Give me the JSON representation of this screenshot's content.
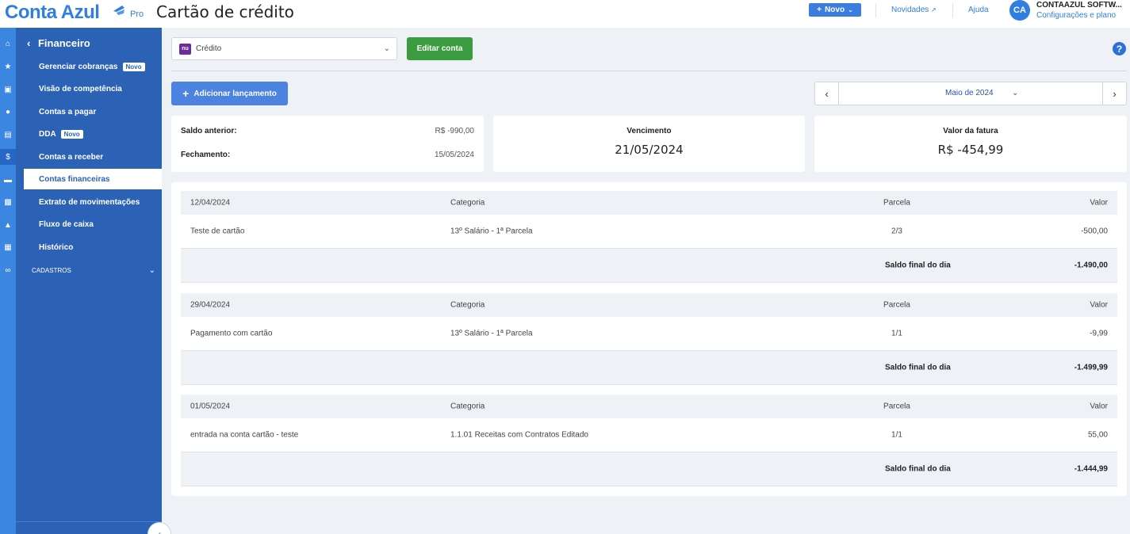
{
  "header": {
    "logo_text": "Conta Azul",
    "logo_badge": "Pro",
    "page_title": "Cartão de crédito",
    "new_button": "Novo",
    "novidades": "Novidades",
    "ajuda": "Ajuda",
    "avatar_initials": "CA",
    "company_name": "CONTAAZUL SOFTW...",
    "settings_link": "Configurações e plano"
  },
  "sidebar": {
    "section_title": "Financeiro",
    "items": [
      {
        "label": "Gerenciar cobranças",
        "badge": "Novo"
      },
      {
        "label": "Visão de competência"
      },
      {
        "label": "Contas a pagar"
      },
      {
        "label": "DDA",
        "badge": "Novo"
      },
      {
        "label": "Contas a receber"
      },
      {
        "label": "Contas financeiras",
        "active": true
      },
      {
        "label": "Extrato de movimentações"
      },
      {
        "label": "Fluxo de caixa"
      },
      {
        "label": "Histórico"
      }
    ],
    "cadastros": "CADASTROS"
  },
  "toolbar": {
    "account_name": "Crédito",
    "account_logo": "nu",
    "edit_button": "Editar conta",
    "add_button": "Adicionar lançamento",
    "month": "Maio de 2024"
  },
  "summary": {
    "saldo_anterior_label": "Saldo anterior:",
    "saldo_anterior_value": "R$ -990,00",
    "fechamento_label": "Fechamento:",
    "fechamento_value": "15/05/2024",
    "vencimento_label": "Vencimento",
    "vencimento_value": "21/05/2024",
    "fatura_label": "Valor da fatura",
    "fatura_value": "R$ -454,99"
  },
  "table": {
    "col_categoria": "Categoria",
    "col_parcela": "Parcela",
    "col_valor": "Valor",
    "total_label": "Saldo final do dia",
    "groups": [
      {
        "date": "12/04/2024",
        "description": "Teste de cartão",
        "category": "13º Salário - 1ª Parcela",
        "installment": "2/3",
        "value": "-500,00",
        "total": "-1.490,00"
      },
      {
        "date": "29/04/2024",
        "description": "Pagamento com cartão",
        "category": "13º Salário - 1ª Parcela",
        "installment": "1/1",
        "value": "-9,99",
        "total": "-1.499,99"
      },
      {
        "date": "01/05/2024",
        "description": "entrada na conta cartão - teste",
        "category": "1.1.01 Receitas com Contratos Editado",
        "installment": "1/1",
        "value": "55,00",
        "total": "-1.444,99"
      }
    ]
  },
  "colors": {
    "brand": "#2f7ee0",
    "sidebar": "#2b62b6",
    "edit_button": "#3a9c3f"
  }
}
